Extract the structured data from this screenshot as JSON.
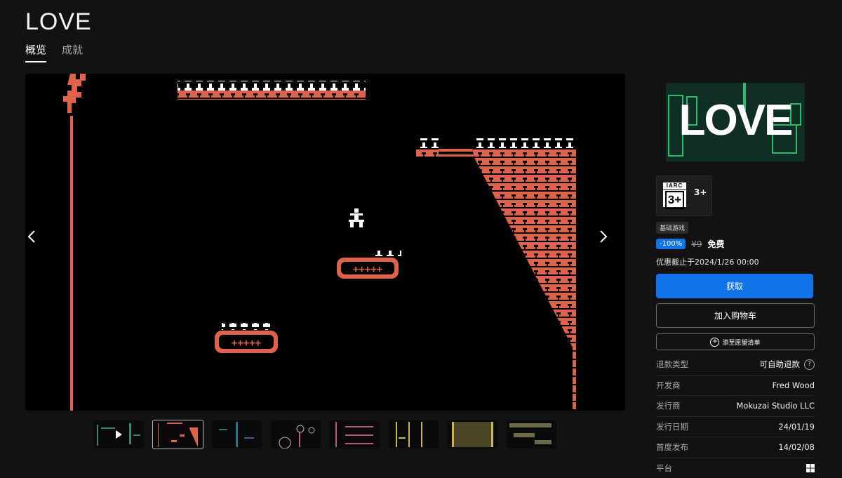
{
  "app": {
    "title": "LOVE"
  },
  "tabs": [
    {
      "label": "概览",
      "active": true
    },
    {
      "label": "成就",
      "active": false
    }
  ],
  "media": {
    "prev_icon": "chevron-left-icon",
    "next_icon": "chevron-right-icon",
    "thumbnail_count": 8,
    "active_thumbnail": 2,
    "game_colors": {
      "brick": "#e0624b",
      "spike": "#ffffff",
      "background": "#000000"
    }
  },
  "sidebar": {
    "logo_text": "LOVE",
    "rating": {
      "badge_top": "IARC",
      "badge_value": "3+",
      "age": "3+"
    },
    "base_tag": "基础游戏",
    "price": {
      "discount": "-100%",
      "original": "¥9",
      "final": "免费"
    },
    "deadline": "优惠截止于2024/1/26 00:00",
    "buttons": {
      "get": "获取",
      "cart": "加入购物车",
      "wishlist": "添至愿望清单"
    },
    "info": [
      {
        "label": "退款类型",
        "value": "可自助退款"
      },
      {
        "label": "开发商",
        "value": "Fred Wood"
      },
      {
        "label": "发行商",
        "value": "Mokuzai Studio LLC"
      },
      {
        "label": "发行日期",
        "value": "24/01/19"
      },
      {
        "label": "首度发布",
        "value": "14/02/08"
      },
      {
        "label": "平台",
        "value": ""
      }
    ],
    "platform_icon": "windows-icon"
  },
  "colors": {
    "accent": "#0e74e8",
    "background": "#121212"
  }
}
